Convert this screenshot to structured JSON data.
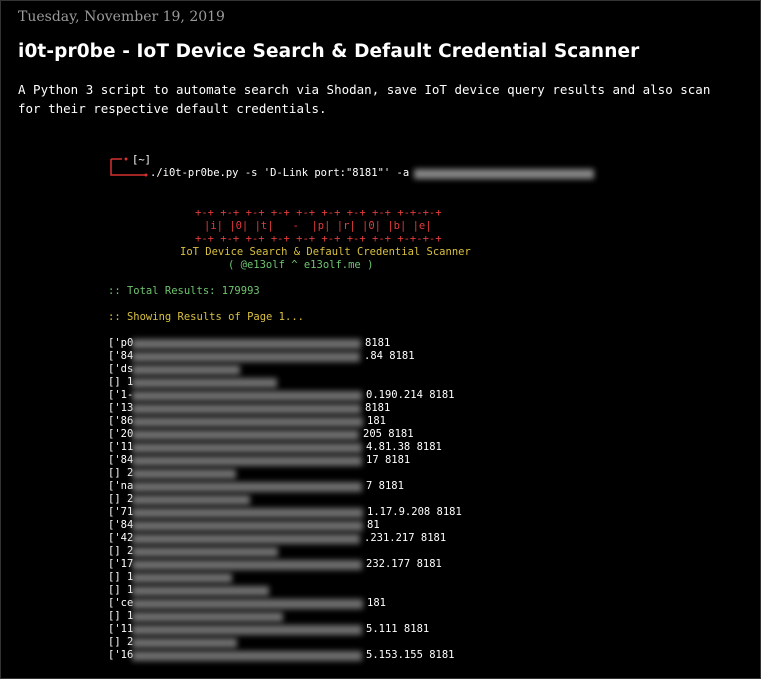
{
  "post": {
    "date": "Tuesday, November 19, 2019",
    "title": "i0t-pr0be - IoT Device Search & Default Credential Scanner",
    "description": "A Python 3 script to automate search via Shodan, save IoT device query results and also scan for their respective default credentials."
  },
  "terminal": {
    "prompt_dir": "[~]",
    "command": "./i0t-pr0be.py -s 'D-Link port:\"8181\"' -a",
    "banner_line1": "+-+ +-+ +-+ +-+ +-+ +-+ +-+ +-+ +-+-+-+",
    "banner_line2": "|i| |0| |t|   -  |p| |r| |0| |b| |e|",
    "banner_line3": "+-+ +-+ +-+ +-+ +-+ +-+ +-+ +-+ +-+-+-+",
    "banner_subtitle": "IoT Device Search & Default Credential Scanner",
    "banner_author": "( @e13olf ^ e13olf.me )",
    "total_results": ":: Total Results: 179993",
    "showing_page": ":: Showing Results of Page 1...",
    "results": [
      {
        "prefix": "['p0",
        "suffix": "8181"
      },
      {
        "prefix": "['84",
        "suffix": ".84 8181"
      },
      {
        "prefix": "['ds",
        "suffix": ""
      },
      {
        "prefix": "[] 1",
        "suffix": ""
      },
      {
        "prefix": "['1-",
        "suffix": "0.190.214 8181"
      },
      {
        "prefix": "['13",
        "suffix": "8181"
      },
      {
        "prefix": "['86",
        "suffix": "181"
      },
      {
        "prefix": "['20",
        "suffix": "205 8181"
      },
      {
        "prefix": "['11",
        "suffix": "4.81.38 8181"
      },
      {
        "prefix": "['84",
        "suffix": "17 8181"
      },
      {
        "prefix": "[] 2",
        "suffix": ""
      },
      {
        "prefix": "['na",
        "suffix": "7 8181"
      },
      {
        "prefix": "[] 2",
        "suffix": ""
      },
      {
        "prefix": "['71",
        "suffix": "1.17.9.208 8181"
      },
      {
        "prefix": "['84",
        "suffix": "81"
      },
      {
        "prefix": "['42",
        "suffix": ".231.217 8181"
      },
      {
        "prefix": "[] 2",
        "suffix": ""
      },
      {
        "prefix": "['17",
        "suffix": "232.177 8181"
      },
      {
        "prefix": "[] 1",
        "suffix": ""
      },
      {
        "prefix": "[] 1",
        "suffix": ""
      },
      {
        "prefix": "['ce",
        "suffix": "181"
      },
      {
        "prefix": "[] 1",
        "suffix": ""
      },
      {
        "prefix": "['11",
        "suffix": "5.111 8181"
      },
      {
        "prefix": "[] 2",
        "suffix": ""
      },
      {
        "prefix": "['16",
        "suffix": "5.153.155 8181"
      }
    ]
  }
}
